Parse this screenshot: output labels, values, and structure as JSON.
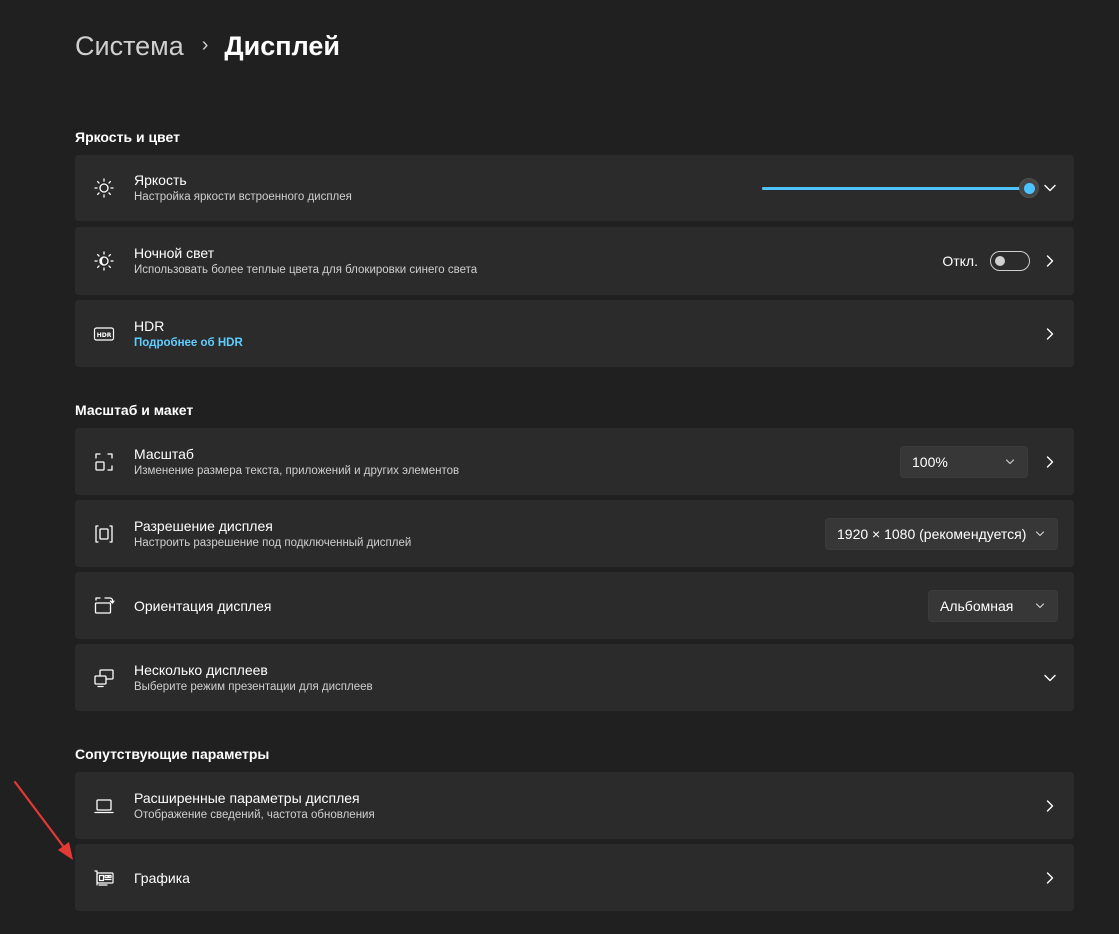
{
  "breadcrumb": {
    "parent": "Система",
    "separator": "›",
    "current": "Дисплей"
  },
  "sections": {
    "brightness_color": "Яркость и цвет",
    "scale_layout": "Масштаб и макет",
    "related": "Сопутствующие параметры"
  },
  "brightness": {
    "title": "Яркость",
    "subtitle": "Настройка яркости встроенного дисплея",
    "value_percent": 100
  },
  "night_light": {
    "title": "Ночной свет",
    "subtitle": "Использовать более теплые цвета для блокировки синего света",
    "state": "Откл."
  },
  "hdr": {
    "title": "HDR",
    "link": "Подробнее об HDR"
  },
  "scale": {
    "title": "Масштаб",
    "subtitle": "Изменение размера текста, приложений и других элементов",
    "value": "100%"
  },
  "resolution": {
    "title": "Разрешение дисплея",
    "subtitle": "Настроить разрешение под подключенный дисплей",
    "value": "1920 × 1080 (рекомендуется)"
  },
  "orientation": {
    "title": "Ориентация дисплея",
    "value": "Альбомная"
  },
  "multiple_displays": {
    "title": "Несколько дисплеев",
    "subtitle": "Выберите режим презентации для дисплеев"
  },
  "advanced_display": {
    "title": "Расширенные параметры дисплея",
    "subtitle": "Отображение сведений, частота обновления"
  },
  "graphics": {
    "title": "Графика"
  },
  "colors": {
    "background": "#202020",
    "card": "#2b2b2b",
    "accent": "#4cc2ff",
    "link": "#60cdff",
    "annotation_arrow": "#e53935"
  },
  "icons": [
    "brightness-icon",
    "night-light-icon",
    "hdr-icon",
    "scale-icon",
    "resolution-icon",
    "orientation-icon",
    "multiple-displays-icon",
    "laptop-icon",
    "graphics-card-icon",
    "chevron-right-icon",
    "chevron-down-icon"
  ]
}
